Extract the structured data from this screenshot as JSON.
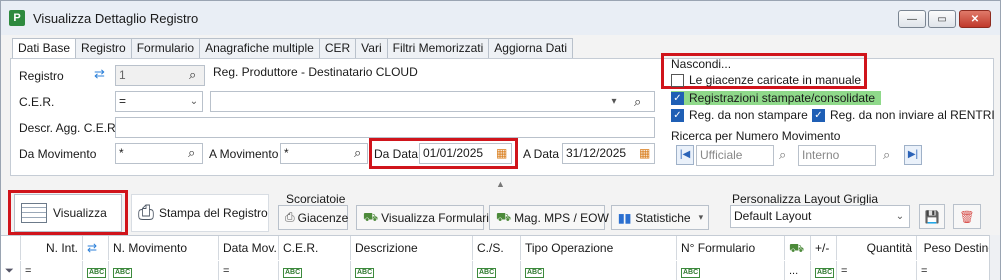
{
  "window": {
    "title": "Visualizza Dettaglio Registro",
    "app_icon": "P",
    "controls": {
      "minimize": "—",
      "maximize": "▭",
      "close": "✕"
    }
  },
  "tabs": [
    "Dati Base",
    "Registro",
    "Formulario",
    "Anagrafiche multiple",
    "CER",
    "Vari",
    "Filtri Memorizzati",
    "Aggiorna Dati"
  ],
  "filters": {
    "registro_label": "Registro",
    "registro_code": "1",
    "registro_name": "Reg. Produttore - Destinatario CLOUD",
    "cer_label": "C.E.R.",
    "cer_operator": "=",
    "cer_value": "",
    "descr_label": "Descr. Agg. C.E.R.",
    "descr_value": "",
    "da_movimento_label": "Da Movimento",
    "da_movimento_value": "*",
    "a_movimento_label": "A Movimento",
    "a_movimento_value": "*",
    "da_data_label": "Da Data",
    "da_data_value": "01/01/2025",
    "a_data_label": "A Data",
    "a_data_value": "31/12/2025"
  },
  "nascondi": {
    "title": "Nascondi...",
    "giacenze_label": "Le giacenze caricate in manuale",
    "giacenze_checked": false,
    "consolidate_label": "Registrazioni stampate/consolidate",
    "consolidate_checked": true,
    "non_stampare_label": "Reg. da non stampare",
    "non_stampare_checked": true,
    "non_inviare_label": "Reg. da non inviare al RENTRI",
    "non_inviare_checked": true
  },
  "ricerca": {
    "title": "Ricerca per Numero Movimento",
    "ufficiale_placeholder": "Ufficiale",
    "interno_placeholder": "Interno"
  },
  "toolbar": {
    "visualizza_label": "Visualizza",
    "stampa_label": "Stampa del Registro",
    "scorciatoie_title": "Scorciatoie",
    "giacenze_label": "Giacenze",
    "visualizza_formulari_label": "Visualizza Formulari",
    "mag_label": "Mag. MPS / EOW",
    "statistiche_label": "Statistiche",
    "layout_title": "Personalizza Layout Griglia",
    "layout_value": "Default Layout"
  },
  "grid": {
    "headers": [
      "N. Int.",
      "",
      "N. Movimento",
      "Data Mov.",
      "C.E.R.",
      "Descrizione",
      "C./S.",
      "Tipo Operazione",
      "N° Formulario",
      "",
      "+/-",
      "Quantità",
      "Peso Destino"
    ],
    "filter_ops": [
      "=",
      "",
      "",
      "=",
      "",
      "",
      "",
      "",
      "",
      "...",
      "",
      "=",
      "="
    ]
  },
  "colors": {
    "accent": "#1f5fb5",
    "highlight": "#d0141b",
    "green_bar": "#8fd98a"
  }
}
